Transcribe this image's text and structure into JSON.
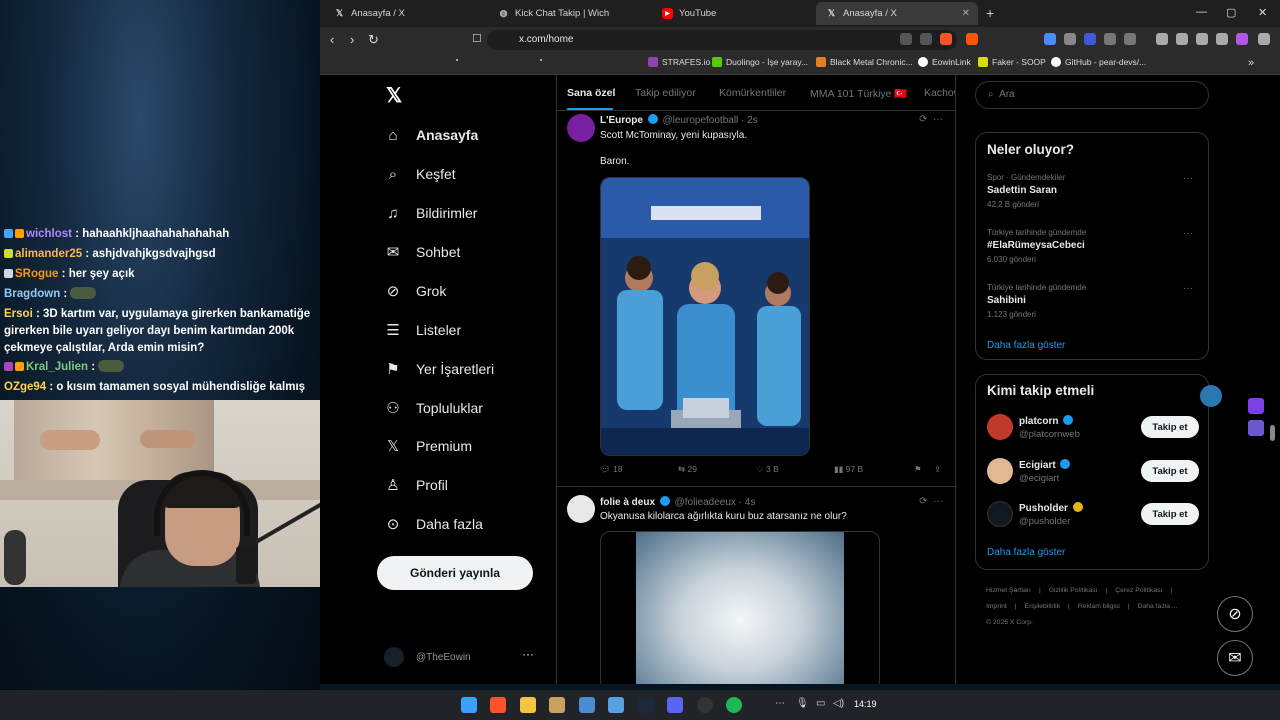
{
  "stream_chat": [
    {
      "user": "wichlost",
      "color": "#b388ff",
      "msg": "hahaahkljhaahahahahahah"
    },
    {
      "user": "alimander25",
      "color": "#ffb74d",
      "msg": "ashjdvahjkgsdvajhgsd"
    },
    {
      "user": "SRogue",
      "color": "#ff9800",
      "msg": "her şey açık"
    },
    {
      "user": "Bragdown",
      "color": "#90caf9",
      "msg": ""
    },
    {
      "user": "Ersoi",
      "color": "#ffd54f",
      "msg": "3D kartım var, uygulamaya girerken bankamatiğe girerken bile uyarı geliyor dayı benim kartımdan 200k çekmeye çalıştılar, Arda emin misin?"
    },
    {
      "user": "Kral_Julien",
      "color": "#81c784",
      "msg": ""
    },
    {
      "user": "OZge94",
      "color": "#ffd54f",
      "msg": "o kısım tamamen sosyal mühendisliğe kalmış ya"
    }
  ],
  "browser": {
    "tabs": [
      {
        "title": "Anasayfa / X",
        "icon": "x-icon"
      },
      {
        "title": "Kick Chat Takip | Wich",
        "icon": "globe-icon"
      },
      {
        "title": "YouTube",
        "icon": "youtube-icon"
      },
      {
        "title": "Anasayfa / X",
        "icon": "x-icon",
        "active": true
      }
    ],
    "url": "x.com/home",
    "bookmarks": [
      {
        "label": "STRAFES.io",
        "color": "#8e44ad"
      },
      {
        "label": "Duolingo - İşe yaray...",
        "color": "#58cc02"
      },
      {
        "label": "Black Metal Chronic...",
        "color": "#e67e22"
      },
      {
        "label": "EowinLink",
        "color": "#ffffff"
      },
      {
        "label": "Faker - SOOP",
        "color": "#d4e000"
      },
      {
        "label": "GitHub - pear-devs/...",
        "color": "#ffffff"
      }
    ],
    "new_tab": "+",
    "overflow": "»"
  },
  "x": {
    "nav": [
      {
        "label": "Anasayfa",
        "icon": "home-icon",
        "active": true
      },
      {
        "label": "Keşfet",
        "icon": "search-icon"
      },
      {
        "label": "Bildirimler",
        "icon": "bell-icon"
      },
      {
        "label": "Sohbet",
        "icon": "mail-icon"
      },
      {
        "label": "Grok",
        "icon": "grok-icon"
      },
      {
        "label": "Listeler",
        "icon": "list-icon"
      },
      {
        "label": "Yer İşaretleri",
        "icon": "bookmark-icon"
      },
      {
        "label": "Topluluklar",
        "icon": "communities-icon"
      },
      {
        "label": "Premium",
        "icon": "x-premium-icon"
      },
      {
        "label": "Profil",
        "icon": "person-icon"
      },
      {
        "label": "Daha fazla",
        "icon": "more-circle-icon"
      }
    ],
    "post_button": "Gönderi yayınla",
    "profile_handle": "@TheEowin",
    "feed_tabs": [
      "Sana özel",
      "Takip ediliyor",
      "Kömürkentliler",
      "MMA 101 Türkiye 🇹🇷",
      "Kachow"
    ],
    "tweets": [
      {
        "name": "L'Europe",
        "handle": "@leuropefootball",
        "time": "· 2s",
        "text1": "Scott McTominay, yeni kupasıyla.",
        "text2": "Baron.",
        "replies": "18",
        "retweets": "29",
        "likes": "3 B",
        "views": "97 B"
      },
      {
        "name": "folie à deux",
        "handle": "@folieadeeux",
        "time": "· 4s",
        "text1": "Okyanusa kilolarca ağırlıkta kuru buz atarsanız ne olur?"
      }
    ],
    "search_placeholder": "Ara",
    "trends_title": "Neler oluyor?",
    "trends": [
      {
        "meta": "Spor · Gündemdekiler",
        "name": "Sadettin Saran",
        "count": "42,2 B gönderi"
      },
      {
        "meta": "Türkiye tarihinde gündemde",
        "name": "#ElaRümeysaCebeci",
        "count": "6.030 gönderi"
      },
      {
        "meta": "Türkiye tarihinde gündemde",
        "name": "Sahibini",
        "count": "1.123 gönderi"
      }
    ],
    "show_more": "Daha fazla göster",
    "who_to_follow_title": "Kimi takip etmeli",
    "follow_suggestions": [
      {
        "name": "platcorn",
        "handle": "@platcornweb",
        "button": "Takip et",
        "color": "#c0392b"
      },
      {
        "name": "Ecigiart",
        "handle": "@ecigiart",
        "button": "Takip et",
        "color": "#e0b894"
      },
      {
        "name": "Pusholder",
        "handle": "@pusholder",
        "button": "Takip et",
        "color": "#101820"
      }
    ],
    "footer": [
      "Hizmet Şartları",
      "|",
      "Gizlilik Politikası",
      "|",
      "Çerez Politikası",
      "|",
      "Imprint",
      "|",
      "Erişilebilirlik",
      "|",
      "Reklam bilgisi",
      "|",
      "Daha fazla ...",
      "© 2025 X Corp."
    ]
  },
  "taskbar": {
    "time": "14:19"
  }
}
